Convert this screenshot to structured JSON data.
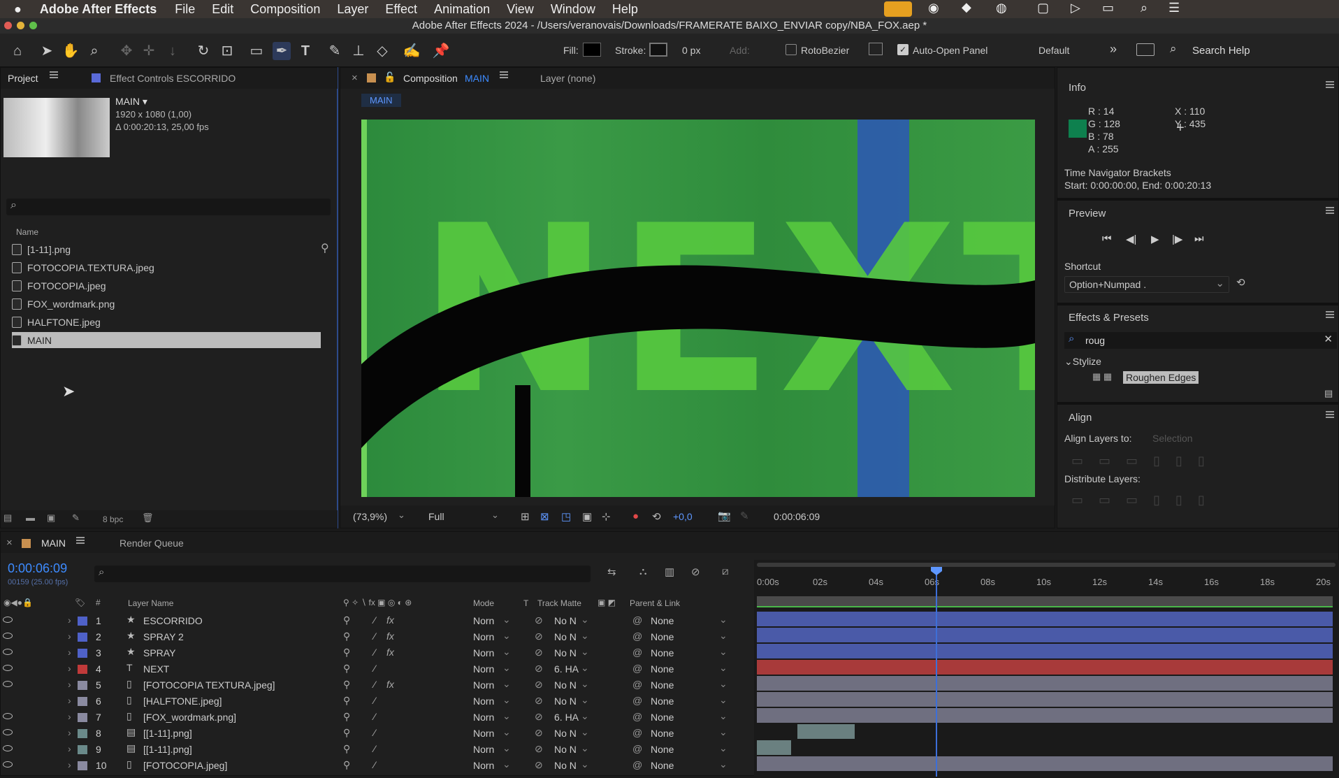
{
  "menubar": {
    "apple": "",
    "app": "Adobe After Effects",
    "items": [
      "File",
      "Edit",
      "Composition",
      "Layer",
      "Effect",
      "Animation",
      "View",
      "Window",
      "Help"
    ]
  },
  "titlebar": {
    "title": "Adobe After Effects 2024 - /Users/veranovais/Downloads/FRAMERATE BAIXO_ENVIAR copy/NBA_FOX.aep *"
  },
  "toolbar": {
    "fill": "Fill:",
    "stroke": "Stroke:",
    "stroke_px": "0 px",
    "add": "Add:",
    "rotobezier": "RotoBezier",
    "auto_open": "Auto-Open Panel",
    "workspace": "Default",
    "search_help": "Search Help"
  },
  "project": {
    "tab": "Project",
    "effect_controls": "Effect Controls ESCORRIDO",
    "comp_name": "MAIN ▾",
    "comp_dims": "1920 x 1080 (1,00)",
    "comp_dur": "Δ 0:00:20:13, 25,00 fps",
    "name_col": "Name",
    "items": [
      {
        "name": "[1-11].png",
        "icon": "sequence"
      },
      {
        "name": "FOTOCOPIA.TEXTURA.jpeg",
        "icon": "file"
      },
      {
        "name": "FOTOCOPIA.jpeg",
        "icon": "file"
      },
      {
        "name": "FOX_wordmark.png",
        "icon": "file"
      },
      {
        "name": "HALFTONE.jpeg",
        "icon": "file"
      },
      {
        "name": "MAIN",
        "icon": "comp"
      }
    ],
    "bpc": "8 bpc"
  },
  "composition": {
    "tab_prefix": "Composition",
    "tab_name": "MAIN",
    "layer_tab": "Layer (none)",
    "crumb": "MAIN",
    "canvas_text": "NEXT",
    "zoom": "(73,9%)",
    "resolution": "Full",
    "exposure": "+0,0",
    "timecode": "0:00:06:09"
  },
  "info": {
    "title": "Info",
    "r": "R : 14",
    "g": "G : 128",
    "b": "B : 78",
    "a": "A : 255",
    "x": "X : 110",
    "y": "Y : 435",
    "swatch": "#0e804e",
    "nav_title": "Time Navigator Brackets",
    "nav_range": "Start: 0:00:00:00, End: 0:00:20:13"
  },
  "preview": {
    "title": "Preview",
    "shortcut_label": "Shortcut",
    "shortcut_value": "Option+Numpad ."
  },
  "effects": {
    "title": "Effects & Presets",
    "search": "roug",
    "category": "Stylize",
    "effect": "Roughen Edges"
  },
  "align": {
    "title": "Align",
    "align_to_label": "Align Layers to:",
    "align_to_value": "Selection",
    "distribute": "Distribute Layers:"
  },
  "timeline": {
    "tab": "MAIN",
    "render_queue": "Render Queue",
    "timecode": "0:00:06:09",
    "frames": "00159 (25.00 fps)",
    "col_layer": "Layer Name",
    "col_mode": "Mode",
    "col_t": "T",
    "col_track": "Track Matte",
    "col_parent": "Parent & Link",
    "ruler": [
      "0:00s",
      "02s",
      "04s",
      "06s",
      "08s",
      "10s",
      "12s",
      "14s",
      "16s",
      "18s",
      "20s"
    ],
    "layers": [
      {
        "num": "1",
        "name": "ESCORRIDO",
        "type": "star",
        "label": "#4f61c8",
        "mode": "Norn",
        "matte": "No N",
        "parent": "None",
        "fx": true,
        "bar": "#4a5aa8",
        "bar_start": 0.0,
        "bar_end": 1.0
      },
      {
        "num": "2",
        "name": "SPRAY 2",
        "type": "star",
        "label": "#4f61c8",
        "mode": "Norn",
        "matte": "No N",
        "parent": "None",
        "fx": true,
        "bar": "#4a5aa8",
        "bar_start": 0.0,
        "bar_end": 1.0
      },
      {
        "num": "3",
        "name": "SPRAY",
        "type": "star",
        "label": "#4f61c8",
        "mode": "Norn",
        "matte": "No N",
        "parent": "None",
        "fx": true,
        "bar": "#4a5aa8",
        "bar_start": 0.0,
        "bar_end": 1.0
      },
      {
        "num": "4",
        "name": "NEXT",
        "type": "text",
        "label": "#c03a3a",
        "mode": "Norn",
        "matte": "6. HA",
        "parent": "None",
        "fx": false,
        "bar": "#a83a3a",
        "bar_start": 0.0,
        "bar_end": 1.0
      },
      {
        "num": "5",
        "name": "[FOTOCOPIA TEXTURA.jpeg]",
        "type": "file",
        "label": "#8a8aa0",
        "mode": "Norn",
        "matte": "No N",
        "parent": "None",
        "fx": true,
        "bar": "#6f6f80",
        "bar_start": 0.0,
        "bar_end": 1.0
      },
      {
        "num": "6",
        "name": "[HALFTONE.jpeg]",
        "type": "file",
        "label": "#8a8aa0",
        "mode": "Norn",
        "matte": "No N",
        "parent": "None",
        "fx": false,
        "bar": "#6f6f80",
        "bar_start": 0.0,
        "bar_end": 1.0
      },
      {
        "num": "7",
        "name": "[FOX_wordmark.png]",
        "type": "file",
        "label": "#8a8aa0",
        "mode": "Norn",
        "matte": "6. HA",
        "parent": "None",
        "fx": false,
        "bar": "#6f6f80",
        "bar_start": 0.0,
        "bar_end": 1.0
      },
      {
        "num": "8",
        "name": "[[1-11].png]",
        "type": "seq",
        "label": "#6a8a8a",
        "mode": "Norn",
        "matte": "No N",
        "parent": "None",
        "fx": false,
        "bar": "#6a8080",
        "bar_start": 0.07,
        "bar_end": 0.17
      },
      {
        "num": "9",
        "name": "[[1-11].png]",
        "type": "seq",
        "label": "#6a8a8a",
        "mode": "Norn",
        "matte": "No N",
        "parent": "None",
        "fx": false,
        "bar": "#6a8080",
        "bar_start": 0.0,
        "bar_end": 0.06
      },
      {
        "num": "10",
        "name": "[FOTOCOPIA.jpeg]",
        "type": "file",
        "label": "#8a8aa0",
        "mode": "Norn",
        "matte": "No N",
        "parent": "None",
        "fx": false,
        "bar": "#6f6f80",
        "bar_start": 0.0,
        "bar_end": 1.0
      }
    ]
  }
}
